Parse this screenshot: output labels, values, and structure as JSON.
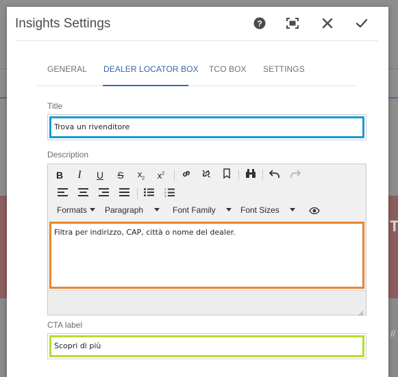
{
  "dialog": {
    "title": "Insights Settings",
    "actions": {
      "help_icon": "help-icon",
      "fullscreen_icon": "fullscreen-icon",
      "close_icon": "close-icon",
      "confirm_icon": "check-icon"
    }
  },
  "tabs": [
    {
      "label": "GENERAL",
      "active": false
    },
    {
      "label": "DEALER LOCATOR BOX",
      "active": true
    },
    {
      "label": "TCO BOX",
      "active": false
    },
    {
      "label": "SETTINGS",
      "active": false
    }
  ],
  "fields": {
    "title": {
      "label": "Title",
      "value": "Trova un rivenditore",
      "accent": "#1a9ad6"
    },
    "description": {
      "label": "Description",
      "value": "Filtra per indirizzo, CAP, città o nome del dealer.",
      "accent": "#e8862d"
    },
    "cta": {
      "label": "CTA label",
      "value": "Scopri di più",
      "accent": "#b7dc2e"
    }
  },
  "editor": {
    "format_buttons": [
      "bold",
      "italic",
      "underline",
      "strikethrough",
      "subscript",
      "superscript",
      "link",
      "unlink",
      "anchor",
      "find",
      "undo",
      "redo"
    ],
    "align_buttons": [
      "align-left",
      "align-center",
      "align-right",
      "justify",
      "bullet-list",
      "numbered-list"
    ],
    "dropdowns": {
      "formats": "Formats",
      "paragraph": "Paragraph",
      "font_family": "Font Family",
      "font_sizes": "Font Sizes"
    },
    "glyphs": {
      "bold": "B",
      "italic": "I",
      "underline": "U",
      "strike": "S",
      "sub": "x",
      "sup": "x"
    }
  }
}
